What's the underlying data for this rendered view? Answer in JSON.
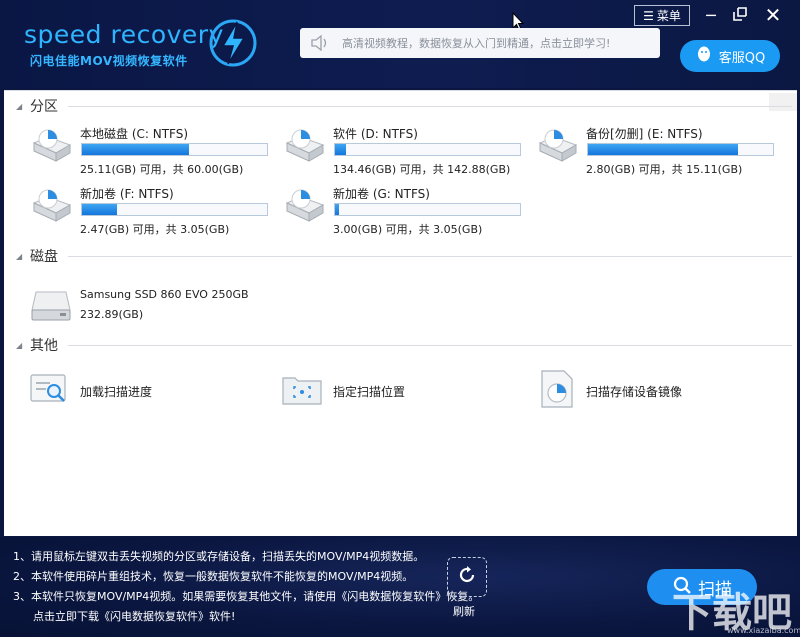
{
  "app": {
    "logo_text": "speed recovery",
    "logo_sub": "闪电佳能MOV视频恢复软件",
    "notice": "高清视频教程，数据恢复从入门到精通，点击立即学习!",
    "customer_service": "客服QQ",
    "menu": "菜单"
  },
  "colors": {
    "accent": "#1e8ef0",
    "bar_fill": "#1c80e0",
    "header_bg": "#0b1740"
  },
  "sections": {
    "partitions": "分区",
    "disks": "磁盘",
    "others": "其他"
  },
  "partitions": [
    {
      "name": "本地磁盘 (C: NTFS)",
      "info": "25.11(GB) 可用，共 60.00(GB)",
      "used": 0.58
    },
    {
      "name": "软件 (D: NTFS)",
      "info": "134.46(GB) 可用，共 142.88(GB)",
      "used": 0.06
    },
    {
      "name": "备份[勿删] (E: NTFS)",
      "info": "2.80(GB) 可用，共 15.11(GB)",
      "used": 0.81
    },
    {
      "name": "新加卷 (F: NTFS)",
      "info": "2.47(GB) 可用，共 3.05(GB)",
      "used": 0.19
    },
    {
      "name": "新加卷 (G: NTFS)",
      "info": "3.00(GB) 可用，共 3.05(GB)",
      "used": 0.02
    }
  ],
  "disk": {
    "name": "Samsung SSD 860 EVO 250GB",
    "size": "232.89(GB)"
  },
  "others": [
    {
      "label": "加载扫描进度",
      "icon": "load-progress-icon"
    },
    {
      "label": "指定扫描位置",
      "icon": "folder-location-icon"
    },
    {
      "label": "扫描存储设备镜像",
      "icon": "disk-image-icon"
    }
  ],
  "tips": [
    "1、请用鼠标左键双击丢失视频的分区或存储设备，扫描丢失的MOV/MP4视频数据。",
    "2、本软件使用碎片重组技术，恢复一般数据恢复软件不能恢复的MOV/MP4视频。",
    "3、本软件只恢复MOV/MP4视频。如果需要恢复其他文件，请使用《闪电数据恢复软件》恢复。",
    "点击立即下载《闪电数据恢复软件》软件!"
  ],
  "refresh_label": "刷新",
  "scan_label": "扫描",
  "watermark": "下载吧",
  "watermark_sub": "www.xiazaiba.com"
}
